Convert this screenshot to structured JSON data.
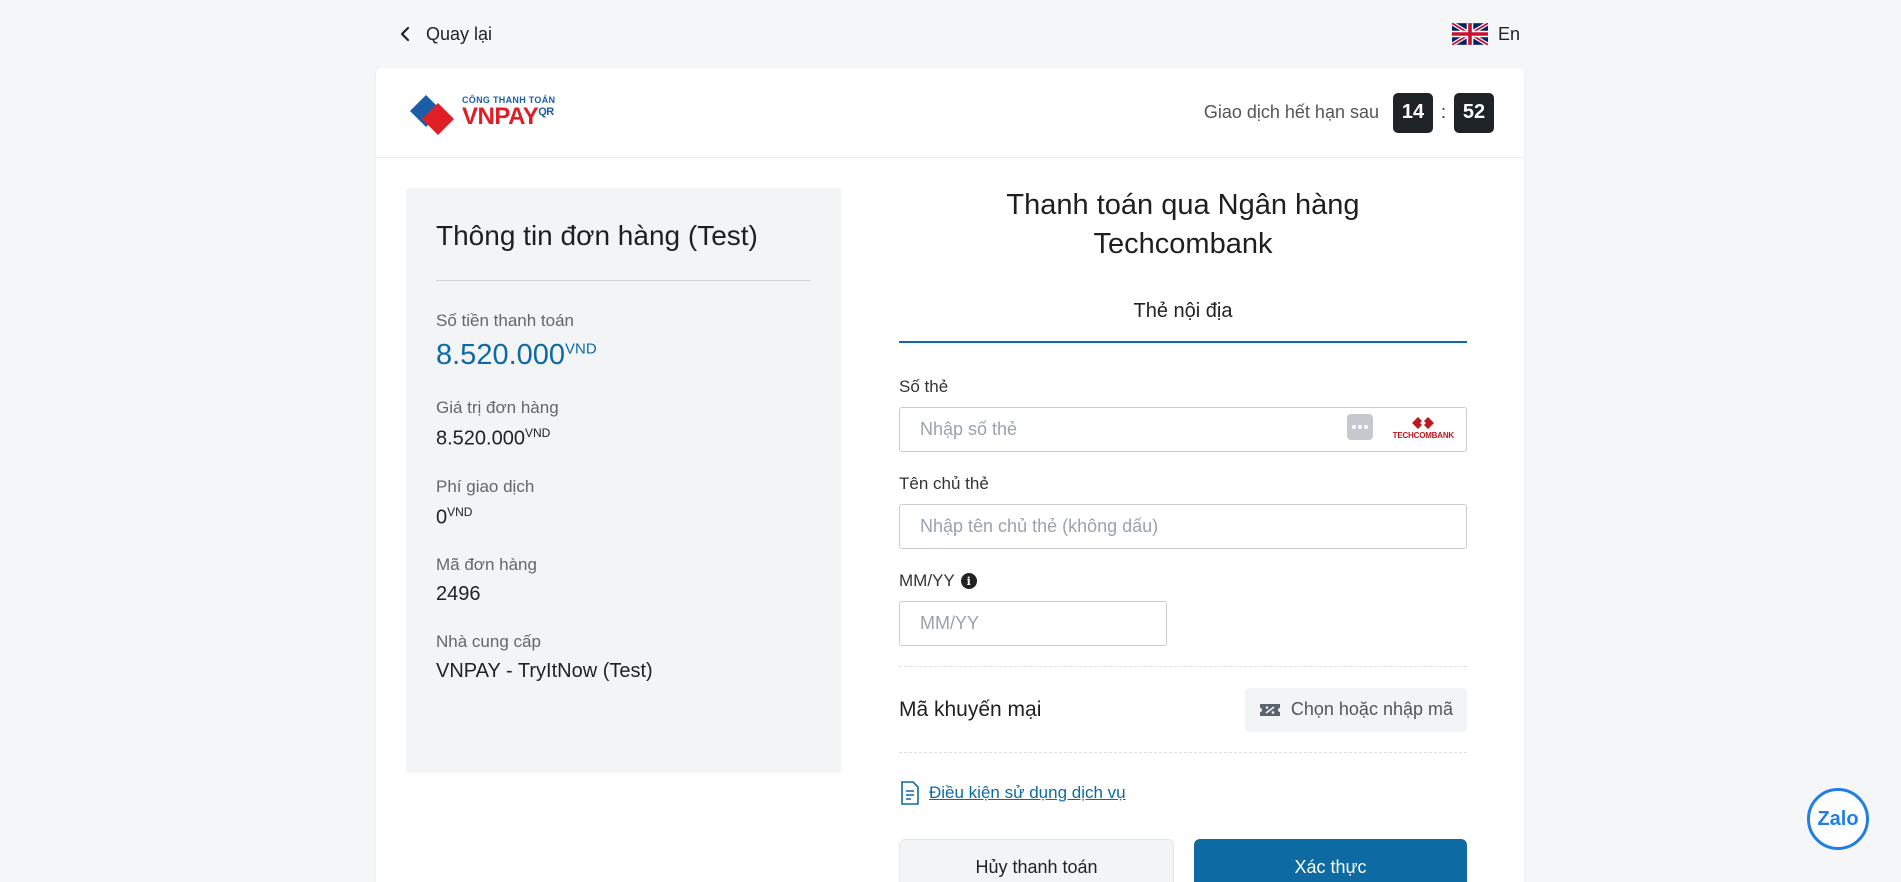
{
  "topbar": {
    "back_label": "Quay lại",
    "lang_label": "En"
  },
  "header": {
    "logo_small": "CỔNG THANH TOÁN",
    "logo_big": "VNPAY",
    "logo_sup": "QR",
    "timer_label": "Giao dịch hết hạn sau",
    "minutes": "14",
    "seconds": "52",
    "sep": ":"
  },
  "order": {
    "title": "Thông tin đơn hàng (Test)",
    "amount_label": "Số tiền thanh toán",
    "amount_value": "8.520.000",
    "currency": "VND",
    "order_value_label": "Giá trị đơn hàng",
    "order_value": "8.520.000",
    "fee_label": "Phí giao dịch",
    "fee_value": "0",
    "order_id_label": "Mã đơn hàng",
    "order_id": "2496",
    "provider_label": "Nhà cung cấp",
    "provider": "VNPAY - TryItNow (Test)"
  },
  "payment": {
    "title_line1": "Thanh toán qua Ngân hàng",
    "title_line2": "Techcombank",
    "tab_label": "Thẻ nội địa",
    "card_number_label": "Số thẻ",
    "card_number_placeholder": "Nhập số thẻ",
    "bank_logo_text": "TECHCOMBANK",
    "holder_label": "Tên chủ thẻ",
    "holder_placeholder": "Nhập tên chủ thẻ (không dấu)",
    "expiry_label": "MM/YY",
    "expiry_placeholder": "MM/YY",
    "promo_label": "Mã khuyến mại",
    "promo_button": "Chọn hoặc nhập mã",
    "terms_link": "Điều kiện sử dụng dịch vụ",
    "cancel_button": "Hủy thanh toán",
    "confirm_button": "Xác thực"
  },
  "zalo": {
    "label": "Zalo"
  },
  "colors": {
    "accent": "#0d6aa5",
    "timer_bg": "#1e2328",
    "panel_bg": "#f2f4f6"
  }
}
